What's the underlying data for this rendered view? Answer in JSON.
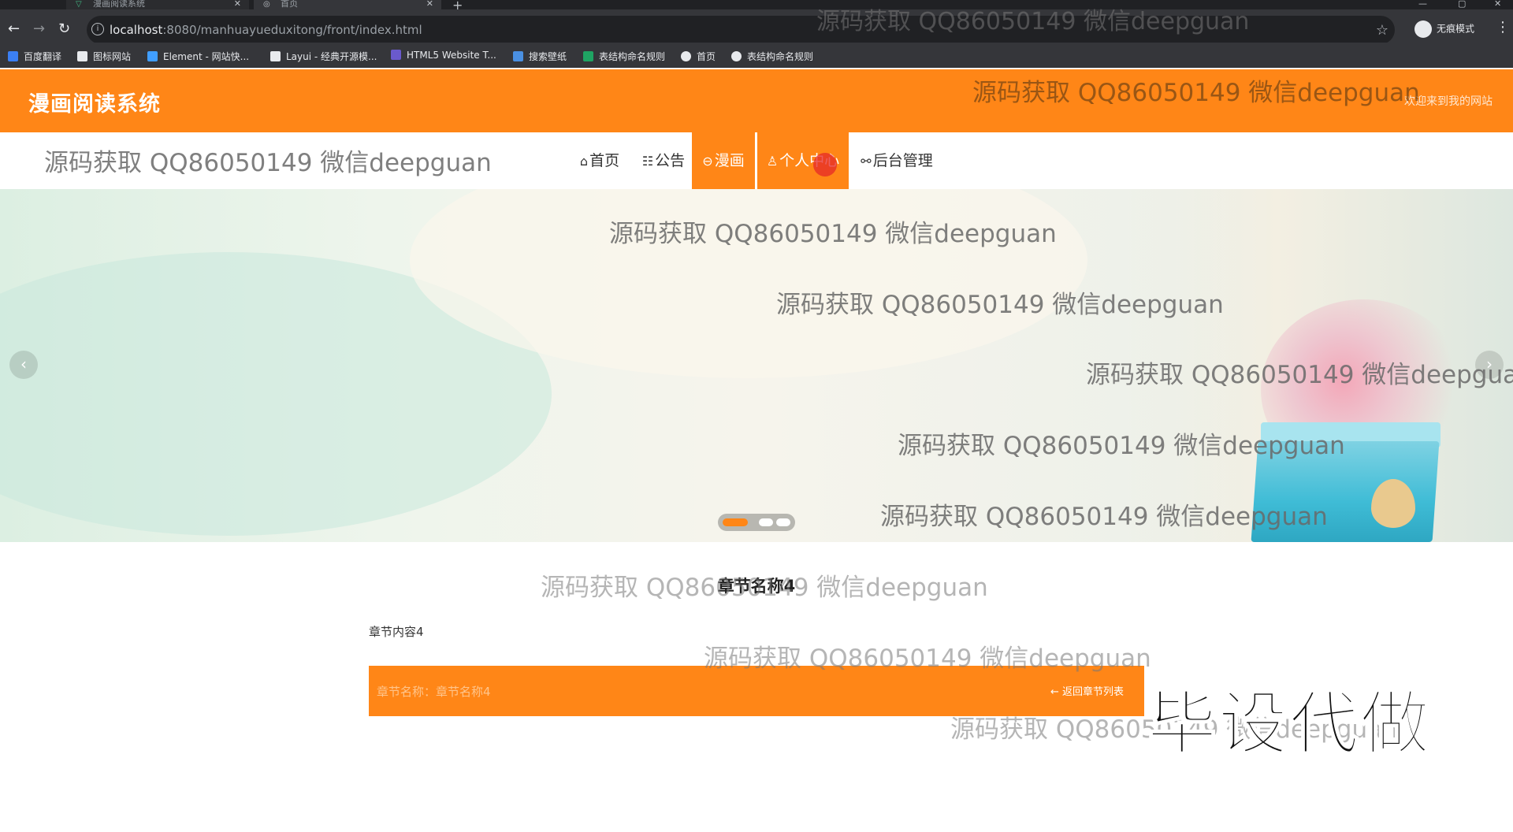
{
  "browser": {
    "tabs": [
      {
        "title": "漫画阅读系统"
      },
      {
        "title": "首页"
      }
    ],
    "new_tab": "+",
    "url_host": "localhost",
    "url_path": ":8080/manhuayueduxitong/front/index.html",
    "incognito_label": "无痕模式",
    "bookmarks": [
      {
        "label": "百度翻译",
        "icon": "baidu-translate-icon",
        "color": "#3b7ff3"
      },
      {
        "label": "图标网站",
        "icon": "flag-icon",
        "color": "#e8eaed"
      },
      {
        "label": "Element - 网站快...",
        "icon": "element-icon",
        "color": "#409eff"
      },
      {
        "label": "Layui - 经典开源模...",
        "icon": "layui-icon",
        "color": "#e8eaed"
      },
      {
        "label": "HTML5 Website T...",
        "icon": "html5-template-icon",
        "color": "#6a5acd"
      },
      {
        "label": "搜索壁纸",
        "icon": "wallpaper-search-icon",
        "color": "#4a90e2"
      },
      {
        "label": "表结构命名规则",
        "icon": "sheet-icon",
        "color": "#1fa463"
      },
      {
        "label": "首页",
        "icon": "globe-icon",
        "color": "#e8eaed"
      },
      {
        "label": "表结构命名规则",
        "icon": "globe-icon",
        "color": "#e8eaed"
      }
    ]
  },
  "site": {
    "title": "漫画阅读系统",
    "welcome": "欢迎来到我的网站",
    "accent": "#ff8617",
    "nav": [
      {
        "label": "首页",
        "icon": "home-icon",
        "glyph": "⌂"
      },
      {
        "label": "公告",
        "icon": "announcement-icon",
        "glyph": "☷"
      },
      {
        "label": "漫画",
        "icon": "comic-icon",
        "glyph": "⊖",
        "active": true
      },
      {
        "label": "个人中心",
        "icon": "user-icon",
        "glyph": "♙",
        "active": true
      },
      {
        "label": "后台管理",
        "icon": "link-icon",
        "glyph": "⚯"
      }
    ]
  },
  "carousel": {
    "slide_count": 3,
    "active_slide": 1,
    "prev_glyph": "‹",
    "next_glyph": "›"
  },
  "chapter": {
    "title": "章节名称4",
    "content": "章节内容4",
    "meta": "章节名称：章节名称4",
    "back_label": "返回章节列表",
    "back_glyph": "←"
  },
  "watermarks": {
    "text": "源码获取 QQ86050149 微信deepguan",
    "stamp": "毕设代做"
  }
}
